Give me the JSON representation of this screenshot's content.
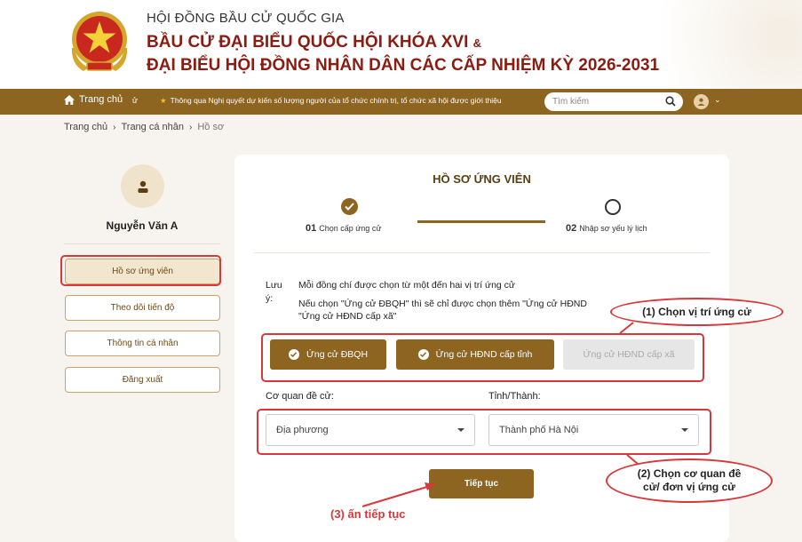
{
  "header": {
    "line1": "HỘI ĐỒNG BẦU CỬ QUỐC GIA",
    "line2": "BẦU CỬ ĐẠI BIỂU QUỐC HỘI KHÓA XVI",
    "line2_suffix": "&",
    "line3": "ĐẠI BIỂU HỘI ĐỒNG NHÂN DÂN CÁC CẤP NHIỆM KỲ 2026-2031",
    "emblem_icon": "national-emblem-icon"
  },
  "navbar": {
    "home_label": "Trang chủ",
    "extra": "ử",
    "ticker": "Thông qua Nghị quyết dự kiến số lượng người của tổ chức chính trị, tổ chức xã hội được giới thiệu",
    "search_placeholder": "Tìm kiếm",
    "color": "#8d6420"
  },
  "breadcrumb": {
    "items": [
      "Trang chủ",
      "Trang cá nhân",
      "Hồ sơ"
    ]
  },
  "sidebar": {
    "user_name": "Nguyễn Văn A",
    "menu": [
      "Hồ sơ ứng viên",
      "Theo dõi tiến độ",
      "Thông tin cá nhân",
      "Đăng xuất"
    ]
  },
  "main": {
    "title": "HỒ SƠ ỨNG VIÊN",
    "steps": [
      {
        "num": "01",
        "label": "Chọn cấp ứng cử",
        "status": "done"
      },
      {
        "num": "02",
        "label": "Nhập sơ yếu lý lịch",
        "status": "pending"
      }
    ],
    "note_label": "Lưu ý:",
    "note_line1": "Mỗi đồng chí được chọn từ một đến hai vị trí ứng cử",
    "note_line2": "Nếu chọn \"Ứng cử ĐBQH\" thì sẽ chỉ được chọn thêm \"Ứng cử HĐND",
    "note_line3": "\"Ứng cử HĐND cấp xã\"",
    "positions": [
      {
        "label": "Ứng cử ĐBQH",
        "selected": true
      },
      {
        "label": "Ứng cử HĐND cấp tỉnh",
        "selected": true
      },
      {
        "label": "Ứng cử HĐND cấp xã",
        "selected": false
      }
    ],
    "agency_label": "Cơ quan đề cử:",
    "agency_value": "Địa phương",
    "province_label": "Tỉnh/Thành:",
    "province_value": "Thành phố Hà Nội",
    "continue_label": "Tiếp tục"
  },
  "annotations": {
    "callout1": "(1) Chọn vị trí ứng cử",
    "callout2_line1": "(2) Chọn cơ quan đề",
    "callout2_line2": "cử/ đơn vị ứng cử",
    "hint3": "(3) ấn tiếp tục",
    "color": "#d8383a"
  }
}
